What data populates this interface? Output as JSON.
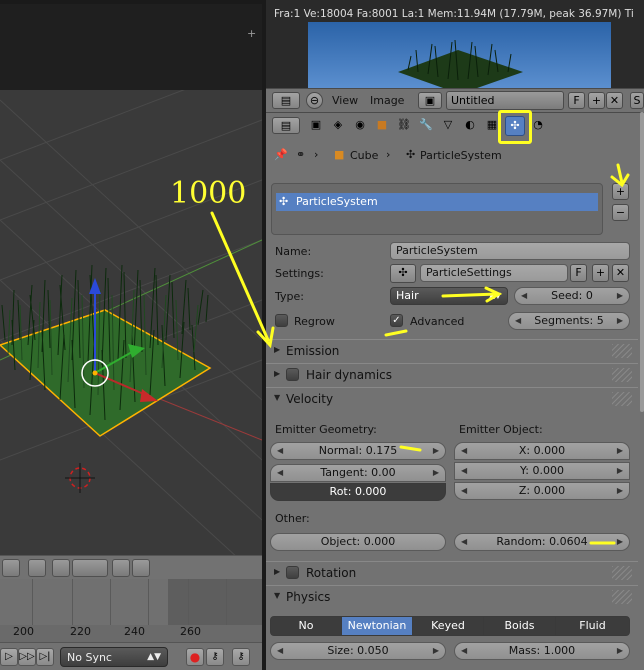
{
  "render_info": "Fra:1  Ve:18004 Fa:8001 La:1 Mem:11.94M (17.79M, peak 36.97M) Ti",
  "annotation_text": "1000",
  "image_header": {
    "menu_view": "View",
    "menu_image": "Image",
    "image_name": "Untitled",
    "fake_user": "F",
    "cut_label": "S"
  },
  "breadcrumb": {
    "object": "Cube",
    "particle_system": "ParticleSystem"
  },
  "particle_list": {
    "item": "ParticleSystem"
  },
  "fields": {
    "name_label": "Name:",
    "name_value": "ParticleSystem",
    "settings_label": "Settings:",
    "settings_value": "ParticleSettings",
    "settings_fake_user": "F",
    "type_label": "Type:",
    "type_value": "Hair",
    "seed": "Seed: 0",
    "regrow_label": "Regrow",
    "advanced_label": "Advanced",
    "segments": "Segments: 5"
  },
  "panels": {
    "emission": "Emission",
    "hair_dynamics": "Hair dynamics",
    "velocity": "Velocity",
    "rotation": "Rotation",
    "physics": "Physics"
  },
  "velocity": {
    "emitter_geometry_label": "Emitter Geometry:",
    "emitter_object_label": "Emitter Object:",
    "normal": "Normal: 0.175",
    "tangent": "Tangent: 0.00",
    "rot": "Rot: 0.000",
    "x": "X: 0.000",
    "y": "Y: 0.000",
    "z": "Z: 0.000",
    "other_label": "Other:",
    "object": "Object: 0.000",
    "random": "Random: 0.0604"
  },
  "physics": {
    "types": [
      "No",
      "Newtonian",
      "Keyed",
      "Boids",
      "Fluid"
    ],
    "selected": "Newtonian",
    "size": "Size: 0.050",
    "mass": "Mass: 1.000"
  },
  "timeline": {
    "ticks": [
      "200",
      "220",
      "240",
      "260"
    ],
    "sync": "No Sync"
  },
  "colors": {
    "selection_blue": "#5680c2",
    "annotation_yellow": "#ffff22",
    "panel_gray": "#727272"
  }
}
